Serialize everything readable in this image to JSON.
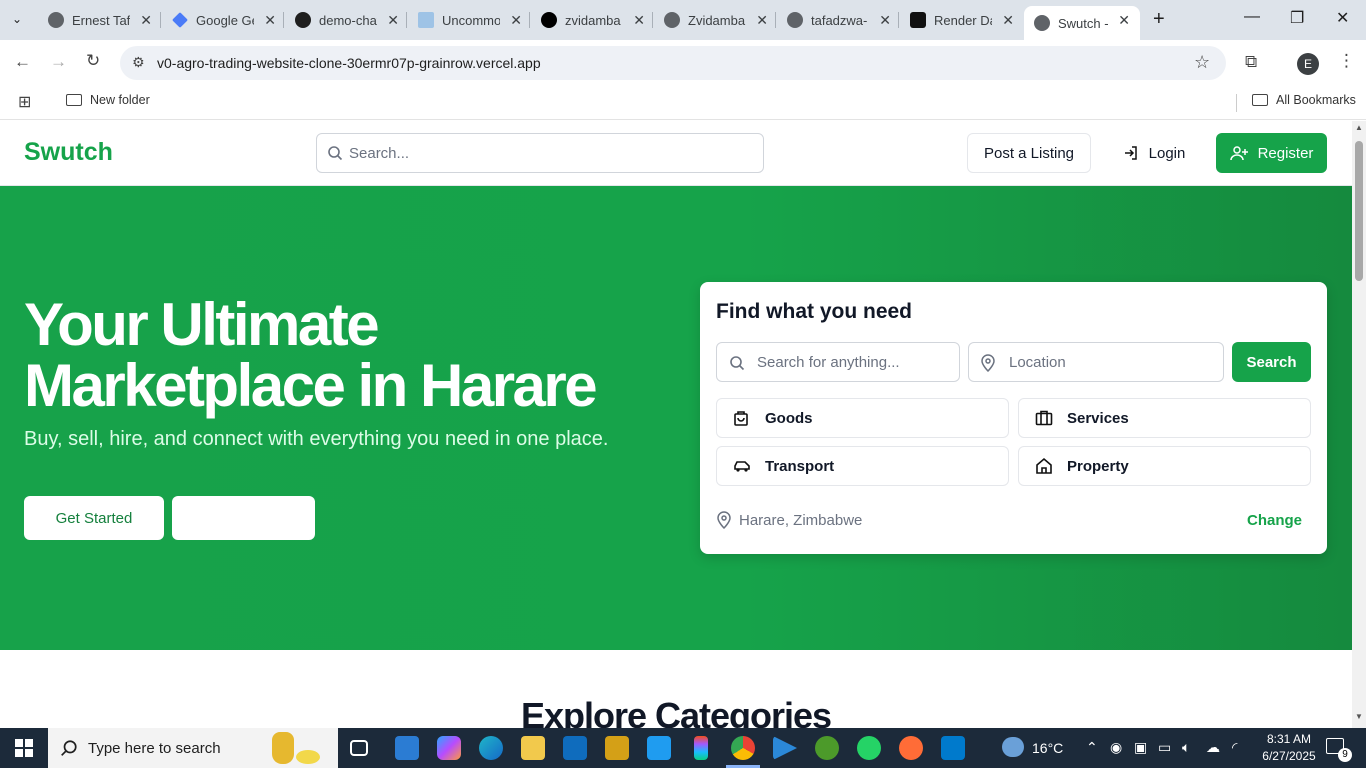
{
  "browser": {
    "tabs": [
      {
        "title": "Ernest Tafadzwa",
        "icon_color": "#5f6368"
      },
      {
        "title": "Google Gemini",
        "icon_color": "#4a7bf7"
      },
      {
        "title": "demo-chat",
        "icon_color": "#1f1f1f"
      },
      {
        "title": "Uncommon",
        "icon_color": "#9ec3e6"
      },
      {
        "title": "zvidamba",
        "icon_color": "#000000"
      },
      {
        "title": "Zvidamba",
        "icon_color": "#5f6368"
      },
      {
        "title": "tafadzwa-",
        "icon_color": "#5f6368"
      },
      {
        "title": "Render Dashboard",
        "icon_color": "#111111"
      },
      {
        "title": "Swutch - ",
        "icon_color": "#5f6368",
        "active": true
      }
    ],
    "url": "v0-agro-trading-website-clone-30ermr07p-grainrow.vercel.app",
    "profile_initial": "E",
    "bookmarks": {
      "folder": "New folder",
      "all": "All Bookmarks"
    }
  },
  "site": {
    "logo": "Swutch",
    "search_placeholder": "Search...",
    "post_listing": "Post a Listing",
    "login": "Login",
    "register": "Register",
    "accent_color": "#16a34a"
  },
  "hero": {
    "title": "Your Ultimate Marketplace in Harare",
    "subtitle": "Buy, sell, hire, and connect with everything you need in one place.",
    "get_started": "Get Started"
  },
  "find": {
    "title": "Find what you need",
    "search_placeholder": "Search for anything...",
    "location_placeholder": "Location",
    "search_button": "Search",
    "categories": [
      {
        "label": "Goods",
        "icon": "shopping-bag-icon"
      },
      {
        "label": "Services",
        "icon": "briefcase-icon"
      },
      {
        "label": "Transport",
        "icon": "car-icon"
      },
      {
        "label": "Property",
        "icon": "home-icon"
      }
    ],
    "location": "Harare, Zimbabwe",
    "change": "Change"
  },
  "section": {
    "heading": "Explore Categories"
  },
  "taskbar": {
    "search_placeholder": "Type here to search",
    "temperature": "16°C",
    "time": "8:31 AM",
    "date": "6/27/2025",
    "notifications": "9"
  }
}
